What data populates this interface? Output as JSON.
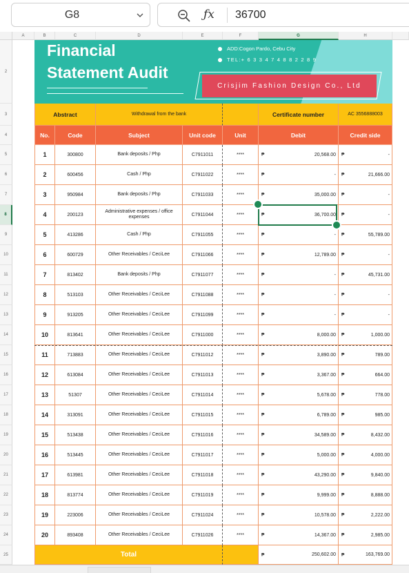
{
  "formula_bar": {
    "cell_ref": "G8",
    "value": "36700"
  },
  "columns": [
    "A",
    "B",
    "C",
    "D",
    "E",
    "F",
    "G",
    "H"
  ],
  "selected_column": "G",
  "selected_row": "8",
  "banner": {
    "title_line1": "Financial",
    "title_line2": "Statement Audit",
    "address": "ADD:Cogon Pardo, Cebu City",
    "tel": "TEL:+ 6 3 3 4 7 4 8 8 2 2 8 9",
    "company": "Crisjim Fashion Design Co., Ltd"
  },
  "abstract_row": {
    "label": "Abstract",
    "text": "Withdrawal from the bank",
    "cert_label": "Certificate number",
    "cert_value": "AC  3556888003"
  },
  "headers": {
    "no": "No.",
    "code": "Code",
    "subject": "Subject",
    "unit_code": "Unit code",
    "unit": "Unit",
    "debit": "Debit",
    "credit": "Credit side"
  },
  "currency_symbol": "₱",
  "rows": [
    {
      "row": "5",
      "no": "1",
      "code": "300800",
      "subject": "Bank deposits /  Php",
      "unit_code": "C7911011",
      "unit": "****",
      "debit": "20,568.00",
      "credit": "-"
    },
    {
      "row": "6",
      "no": "2",
      "code": "600456",
      "subject": "Cash / Php",
      "unit_code": "C7911022",
      "unit": "****",
      "debit": "-",
      "credit": "21,666.00"
    },
    {
      "row": "7",
      "no": "3",
      "code": "950984",
      "subject": "Bank deposits /  Php",
      "unit_code": "C7911033",
      "unit": "****",
      "debit": "35,000.00",
      "credit": "-"
    },
    {
      "row": "8",
      "no": "4",
      "code": "200123",
      "subject": "Administrative expenses / office expenses",
      "unit_code": "C7911044",
      "unit": "****",
      "debit": "36,700.00",
      "credit": "-"
    },
    {
      "row": "9",
      "no": "5",
      "code": "413286",
      "subject": "Cash / Php",
      "unit_code": "C7911055",
      "unit": "****",
      "debit": "-",
      "credit": "55,789.00"
    },
    {
      "row": "10",
      "no": "6",
      "code": "600729",
      "subject": "Other Receivables / CeciLee",
      "unit_code": "C7911066",
      "unit": "****",
      "debit": "12,789.00",
      "credit": "-"
    },
    {
      "row": "11",
      "no": "7",
      "code": "813402",
      "subject": "Bank deposits /  Php",
      "unit_code": "C7911077",
      "unit": "****",
      "debit": "-",
      "credit": "45,731.00"
    },
    {
      "row": "12",
      "no": "8",
      "code": "513103",
      "subject": "Other Receivables / CeciLee",
      "unit_code": "C7911088",
      "unit": "****",
      "debit": "-",
      "credit": "-"
    },
    {
      "row": "13",
      "no": "9",
      "code": "913205",
      "subject": "Other Receivables / CeciLee",
      "unit_code": "C7911099",
      "unit": "****",
      "debit": "-",
      "credit": "-"
    },
    {
      "row": "14",
      "no": "10",
      "code": "813641",
      "subject": "Other Receivables / CeciLee",
      "unit_code": "C7911000",
      "unit": "****",
      "debit": "8,000.00",
      "credit": "1,000.00"
    },
    {
      "row": "15",
      "no": "11",
      "code": "713883",
      "subject": "Other Receivables / CeciLee",
      "unit_code": "C7911012",
      "unit": "****",
      "debit": "3,890.00",
      "credit": "789.00"
    },
    {
      "row": "16",
      "no": "12",
      "code": "613084",
      "subject": "Other Receivables / CeciLee",
      "unit_code": "C7911013",
      "unit": "****",
      "debit": "3,367.00",
      "credit": "664.00"
    },
    {
      "row": "17",
      "no": "13",
      "code": "51307",
      "subject": "Other Receivables / CeciLee",
      "unit_code": "C7911014",
      "unit": "****",
      "debit": "5,678.00",
      "credit": "778.00"
    },
    {
      "row": "18",
      "no": "14",
      "code": "313091",
      "subject": "Other Receivables / CeciLee",
      "unit_code": "C7911015",
      "unit": "****",
      "debit": "6,789.00",
      "credit": "985.00"
    },
    {
      "row": "19",
      "no": "15",
      "code": "513438",
      "subject": "Other Receivables / CeciLee",
      "unit_code": "C7911016",
      "unit": "****",
      "debit": "34,589.00",
      "credit": "8,432.00"
    },
    {
      "row": "20",
      "no": "16",
      "code": "513445",
      "subject": "Other Receivables / CeciLee",
      "unit_code": "C7911017",
      "unit": "****",
      "debit": "5,000.00",
      "credit": "4,000.00"
    },
    {
      "row": "21",
      "no": "17",
      "code": "613981",
      "subject": "Other Receivables / CeciLee",
      "unit_code": "C7911018",
      "unit": "****",
      "debit": "43,290.00",
      "credit": "9,840.00"
    },
    {
      "row": "22",
      "no": "18",
      "code": "813774",
      "subject": "Other Receivables / CeciLee",
      "unit_code": "C7911019",
      "unit": "****",
      "debit": "9,999.00",
      "credit": "8,888.00"
    },
    {
      "row": "23",
      "no": "19",
      "code": "223006",
      "subject": "Other Receivables / CeciLee",
      "unit_code": "C7911024",
      "unit": "****",
      "debit": "10,578.00",
      "credit": "2,222.00"
    },
    {
      "row": "24",
      "no": "20",
      "code": "893408",
      "subject": "Other Receivables / CeciLee",
      "unit_code": "C7911026",
      "unit": "****",
      "debit": "14,367.00",
      "credit": "2,985.00"
    }
  ],
  "total": {
    "row": "25",
    "label": "Total",
    "debit": "250,602.00",
    "credit": "163,769.00"
  },
  "row_labels": {
    "banner": "2",
    "abstract": "3",
    "header": "4"
  }
}
